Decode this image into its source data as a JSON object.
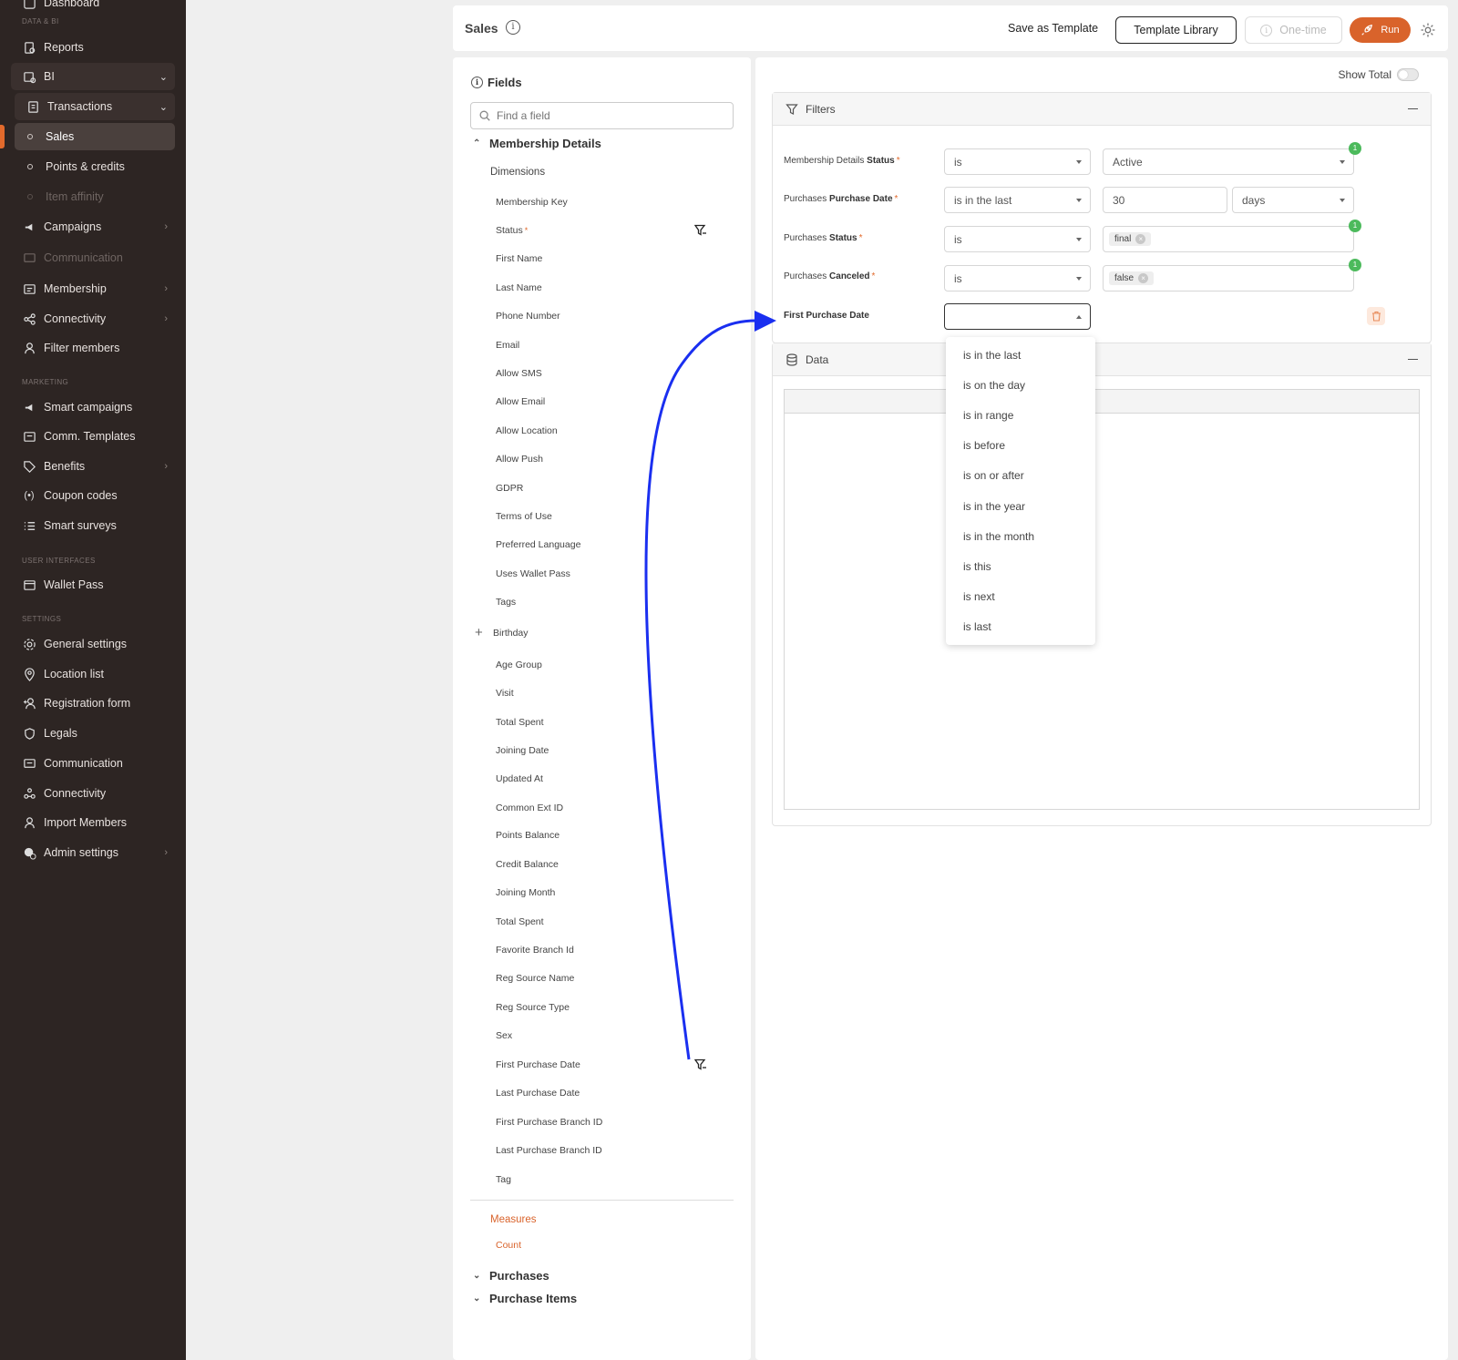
{
  "sidebar": {
    "dashboard": "Dashboard",
    "section_data_bi": "DATA & BI",
    "reports": "Reports",
    "bi": "BI",
    "transactions": "Transactions",
    "sales": "Sales",
    "points_credits": "Points & credits",
    "item_affinity": "Item affinity",
    "campaigns": "Campaigns",
    "communication_dim": "Communication",
    "membership": "Membership",
    "connectivity_top": "Connectivity",
    "filter_members": "Filter members",
    "section_marketing": "MARKETING",
    "smart_campaigns": "Smart campaigns",
    "comm_templates": "Comm. Templates",
    "benefits": "Benefits",
    "coupon_codes": "Coupon codes",
    "smart_surveys": "Smart surveys",
    "section_user_interfaces": "USER INTERFACES",
    "wallet_pass": "Wallet Pass",
    "section_settings": "SETTINGS",
    "general_settings": "General settings",
    "location_list": "Location list",
    "registration_form": "Registration form",
    "legals": "Legals",
    "communication": "Communication",
    "connectivity": "Connectivity",
    "import_members": "Import Members",
    "admin_settings": "Admin settings"
  },
  "header": {
    "title": "Sales",
    "save_template": "Save as Template",
    "template_library": "Template Library",
    "one_time": "One-time",
    "run": "Run"
  },
  "fields_panel": {
    "title": "Fields",
    "search_placeholder": "Find a field",
    "group_membership": "Membership Details",
    "dimensions": "Dimensions",
    "items": [
      "Membership Key",
      "Status",
      "First Name",
      "Last Name",
      "Phone Number",
      "Email",
      "Allow SMS",
      "Allow Email",
      "Allow Location",
      "Allow Push",
      "GDPR",
      "Terms of Use",
      "Preferred Language",
      "Uses Wallet Pass",
      "Tags",
      "Birthday",
      "Age Group",
      "Visit",
      "Total Spent",
      "Joining Date",
      "Updated At",
      "Common Ext ID",
      "Points Balance",
      "Credit Balance",
      "Joining Month",
      "Total Spent",
      "Favorite Branch Id",
      "Reg Source Name",
      "Reg Source Type",
      "Sex",
      "First Purchase Date",
      "Last Purchase Date",
      "First Purchase Branch ID",
      "Last Purchase Branch ID",
      "Tag"
    ],
    "required_mark": "*",
    "plus": "+",
    "measures": "Measures",
    "count": "Count",
    "group_purchases": "Purchases",
    "group_purchase_items": "Purchase Items"
  },
  "main": {
    "show_total": "Show Total",
    "filters_title": "Filters",
    "data_title": "Data",
    "filters": [
      {
        "label_prefix": "Membership Details ",
        "label_bold": "Status",
        "operator": "is",
        "value": "Active",
        "badge": "1"
      },
      {
        "label_prefix": "Purchases ",
        "label_bold": "Purchase Date",
        "operator": "is in the last",
        "value": "30",
        "unit": "days"
      },
      {
        "label_prefix": "Purchases ",
        "label_bold": "Status",
        "operator": "is",
        "chip": "final",
        "badge": "1"
      },
      {
        "label_prefix": "Purchases ",
        "label_bold": "Canceled",
        "operator": "is",
        "chip": "false",
        "badge": "1"
      },
      {
        "label_prefix": "",
        "label_bold": "First Purchase Date",
        "operator": ""
      }
    ],
    "required_mark": "*",
    "chip_x": "×"
  },
  "dropdown": {
    "options": [
      "is in the last",
      "is on the day",
      "is in range",
      "is before",
      "is on or after",
      "is in the year",
      "is in the month",
      "is this",
      "is next",
      "is last"
    ]
  },
  "colors": {
    "accent": "#d9632b",
    "sidebar_bg": "#2d2523",
    "badge_green": "#4cba5c",
    "arrow_blue": "#1a2ff0"
  }
}
